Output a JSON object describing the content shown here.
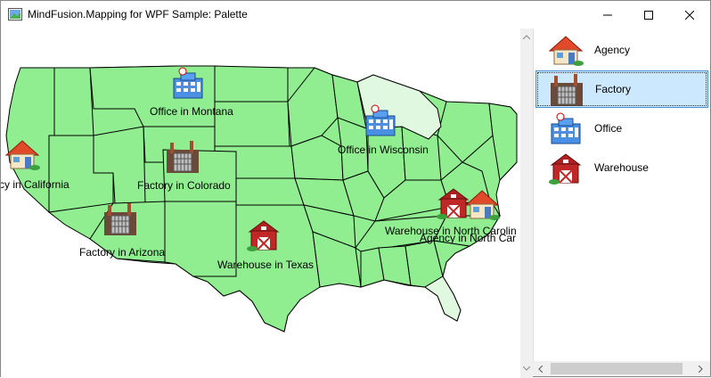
{
  "window": {
    "title": "MindFusion.Mapping for WPF Sample: Palette"
  },
  "colors": {
    "state_fill": "#90ee90",
    "state_fill_light": "#e0f8e0",
    "state_stroke": "#000000",
    "selection": "#cce8ff"
  },
  "map": {
    "markers": [
      {
        "type": "agency",
        "label": "cy in California"
      },
      {
        "type": "office",
        "label": "Office in Montana"
      },
      {
        "type": "factory",
        "label": "Factory in Colorado"
      },
      {
        "type": "factory",
        "label": "Factory in Arizona"
      },
      {
        "type": "office",
        "label": "Office in Wisconsin"
      },
      {
        "type": "warehouse",
        "label": "Warehouse in Texas"
      },
      {
        "type": "warehouse",
        "label": "Warehouse in North Carolin"
      },
      {
        "type": "agency",
        "label": "Agency in North Car"
      }
    ]
  },
  "palette": {
    "items": [
      {
        "icon": "agency-icon",
        "label": "Agency"
      },
      {
        "icon": "factory-icon",
        "label": "Factory",
        "selected": true
      },
      {
        "icon": "office-icon",
        "label": "Office"
      },
      {
        "icon": "warehouse-icon",
        "label": "Warehouse"
      }
    ]
  }
}
